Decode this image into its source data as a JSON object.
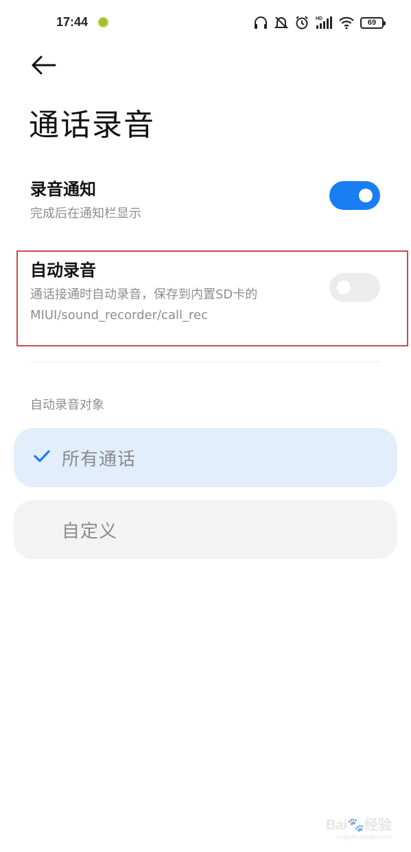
{
  "status_bar": {
    "time": "17:44",
    "battery": "69",
    "network_badge": "HD",
    "icons": [
      "headphones-icon",
      "mute-bell-icon",
      "alarm-icon",
      "signal-icon",
      "wifi-icon",
      "battery-icon"
    ]
  },
  "header": {
    "back_icon": "back-arrow-icon",
    "title": "通话录音"
  },
  "settings": {
    "notification": {
      "title": "录音通知",
      "description": "完成后在通知栏显示",
      "enabled": true
    },
    "auto_record": {
      "title": "自动录音",
      "description_line1": "通话接通时自动录音，保存到内置SD卡的",
      "description_line2": "MIUI/sound_recorder/call_rec",
      "enabled": false
    }
  },
  "auto_record_target": {
    "section_label": "自动录音对象",
    "options": [
      {
        "label": "所有通话",
        "selected": true
      },
      {
        "label": "自定义",
        "selected": false
      }
    ]
  },
  "watermark": {
    "logo_text": "Bai",
    "logo_text_suffix": "经验",
    "url": "jingyan.baidu.com"
  },
  "colors": {
    "accent": "#1a7ef3",
    "selected_bg": "#e3eefc",
    "highlight_border": "#c94b4b"
  }
}
